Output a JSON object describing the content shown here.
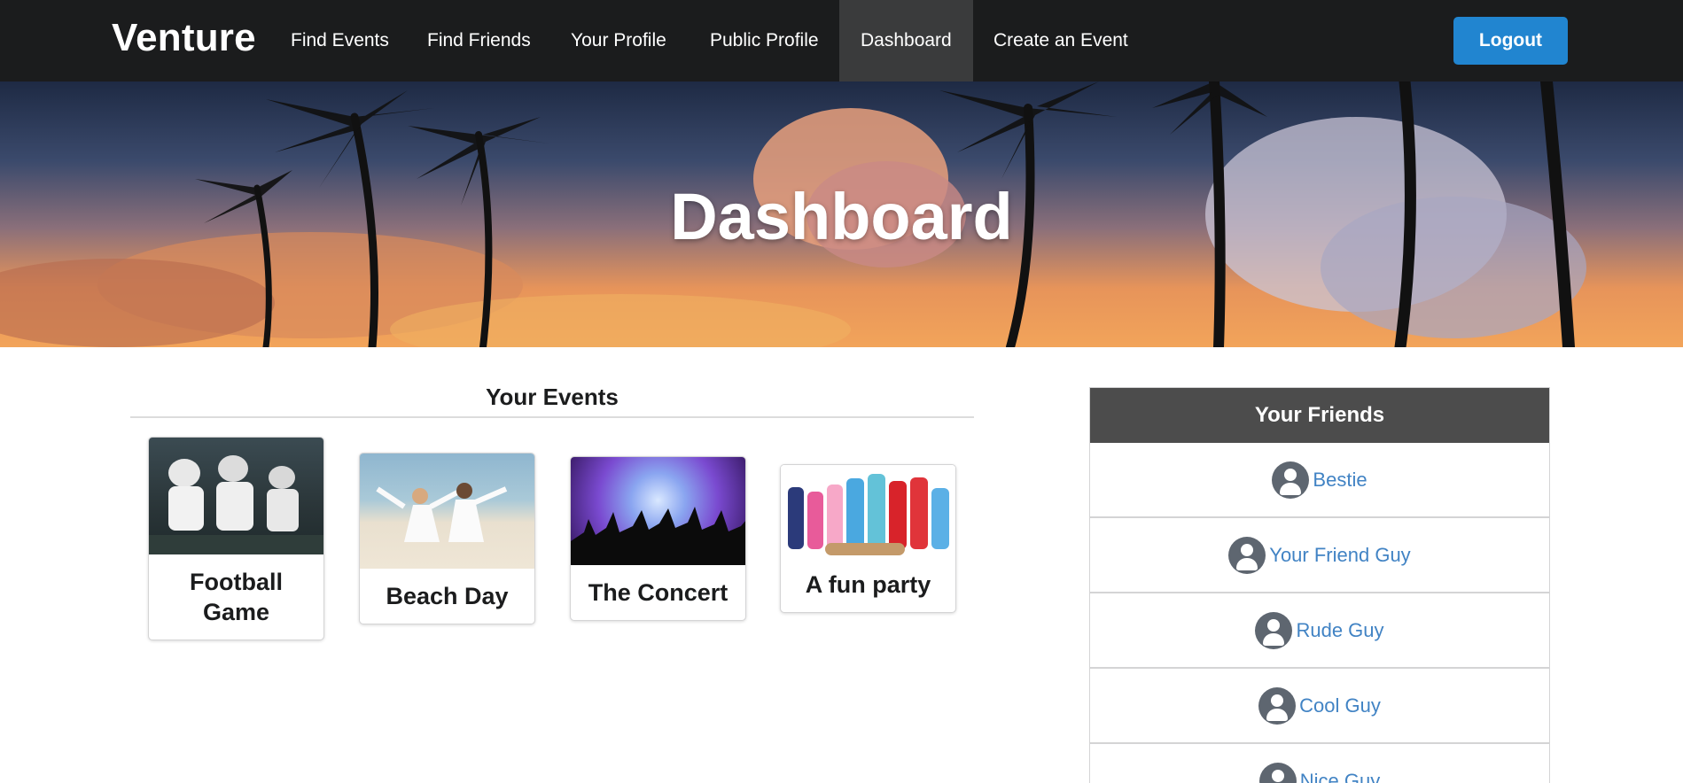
{
  "nav": {
    "brand": "Venture",
    "items": [
      {
        "label": "Find Events"
      },
      {
        "label": "Find Friends"
      },
      {
        "label": "Your Profile"
      },
      {
        "label": "Public Profile"
      },
      {
        "label": "Dashboard",
        "active": true
      },
      {
        "label": "Create an Event"
      }
    ],
    "logout_label": "Logout"
  },
  "hero": {
    "title": "Dashboard"
  },
  "events": {
    "heading": "Your Events",
    "cards": [
      {
        "title": "Football Game",
        "image": "football-photo"
      },
      {
        "title": "Beach Day",
        "image": "beach-yoga-photo"
      },
      {
        "title": "The Concert",
        "image": "concert-crowd-photo"
      },
      {
        "title": "A fun party",
        "image": "pajama-party-photo"
      }
    ]
  },
  "friends": {
    "heading": "Your Friends",
    "list": [
      {
        "name": "Bestie"
      },
      {
        "name": "Your Friend Guy"
      },
      {
        "name": "Rude Guy"
      },
      {
        "name": "Cool Guy"
      },
      {
        "name": "Nice Guy"
      }
    ]
  },
  "colors": {
    "nav_bg": "#1b1c1d",
    "active_nav_bg": "#3a3b3c",
    "logout_bg": "#2185d0",
    "friends_header_bg": "#4c4c4c",
    "link": "#4183c4"
  }
}
